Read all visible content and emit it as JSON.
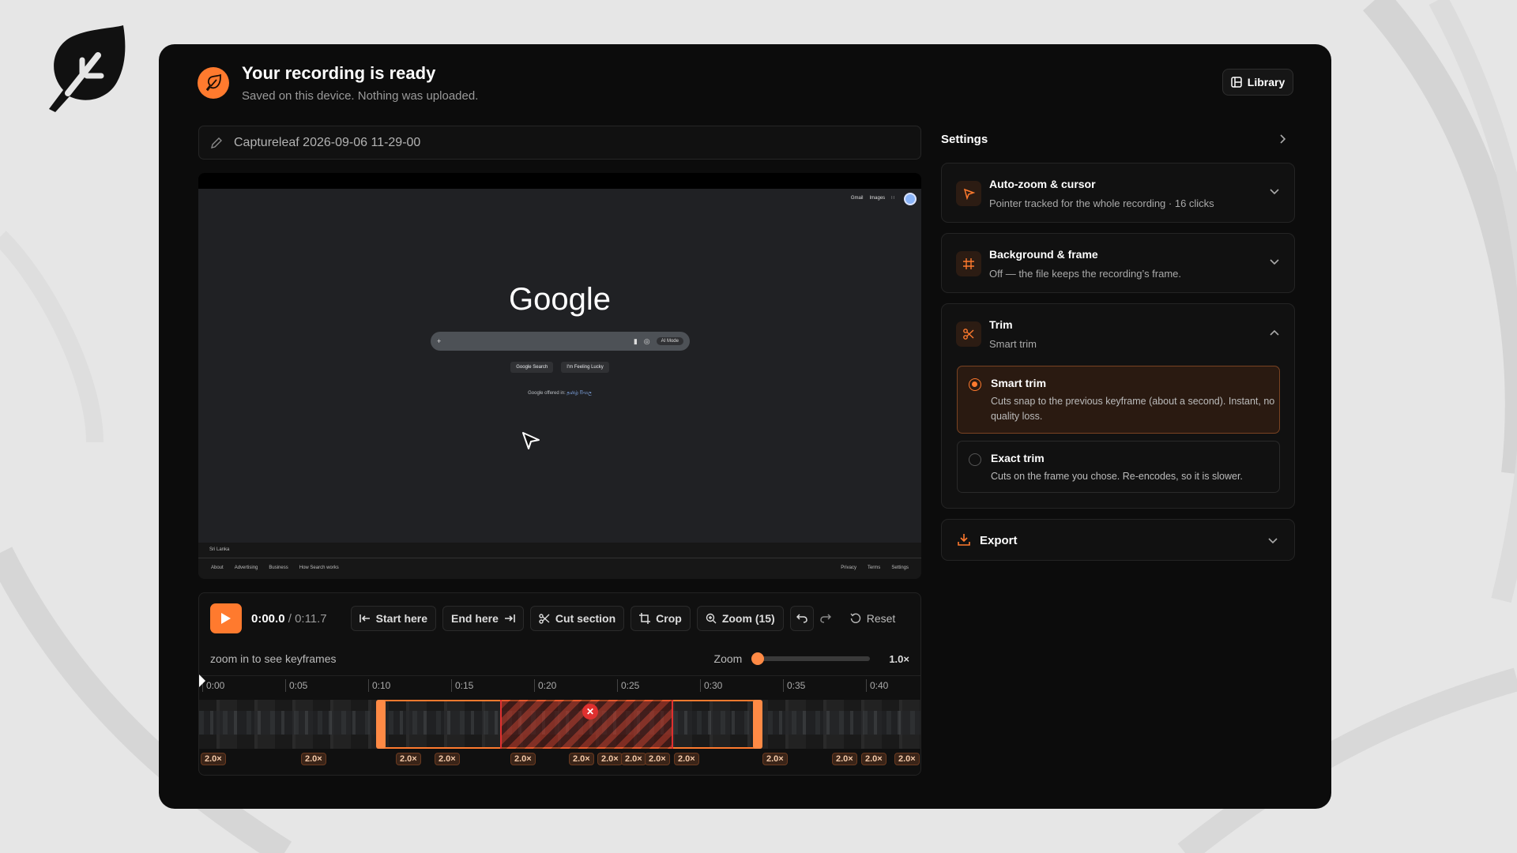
{
  "header": {
    "title": "Your recording is ready",
    "subtitle": "Saved on this device. Nothing was uploaded.",
    "library_label": "Library"
  },
  "recording": {
    "name": "Captureleaf 2026-09-06 11-29-00"
  },
  "preview": {
    "top_links": [
      "Gmail",
      "Images"
    ],
    "logo_text": "Google",
    "search_plus": "+",
    "ai_mode_label": "AI Mode",
    "buttons": [
      "Google Search",
      "I'm Feeling Lucky"
    ],
    "offered_in_prefix": "Google offered in:",
    "offered_in_lang": "தமிழ் සිංහල",
    "country": "Sri Lanka",
    "footer_left": [
      "About",
      "Advertising",
      "Business",
      "How Search works"
    ],
    "footer_right": [
      "Privacy",
      "Terms",
      "Settings"
    ]
  },
  "player": {
    "current_time": "0:00.0",
    "separator": "/",
    "duration": "0:11.7",
    "buttons": {
      "start_here": "Start here",
      "end_here": "End here",
      "cut_section": "Cut section",
      "crop": "Crop",
      "zoom": "Zoom (15)",
      "reset": "Reset"
    }
  },
  "timeline": {
    "keyframe_hint": "zoom in to see keyframes",
    "zoom_label": "Zoom",
    "zoom_value": "1.0×",
    "zoom_level": 0.0,
    "ticks": [
      "0:00",
      "0:05",
      "0:10",
      "0:15",
      "0:20",
      "0:25",
      "0:30",
      "0:35",
      "0:40"
    ],
    "zoom_chip_label": "2.0×"
  },
  "settings": {
    "heading": "Settings",
    "autozoom": {
      "title": "Auto-zoom & cursor",
      "desc": "Pointer tracked for the whole recording · 16 clicks"
    },
    "background": {
      "title": "Background & frame",
      "desc": "Off — the file keeps the recording’s frame."
    },
    "trim": {
      "title": "Trim",
      "desc": "Smart trim",
      "options": [
        {
          "title": "Smart trim",
          "desc": "Cuts snap to the previous keyframe (about a second). Instant, no quality loss.",
          "selected": true
        },
        {
          "title": "Exact trim",
          "desc": "Cuts on the frame you chose. Re-encodes, so it is slower.",
          "selected": false
        }
      ]
    },
    "export": {
      "title": "Export"
    }
  },
  "colors": {
    "accent": "#ff7a2e",
    "card_bg": "#0c0c0c",
    "page_bg": "#e6e6e6",
    "cut_red": "#e0302f"
  }
}
